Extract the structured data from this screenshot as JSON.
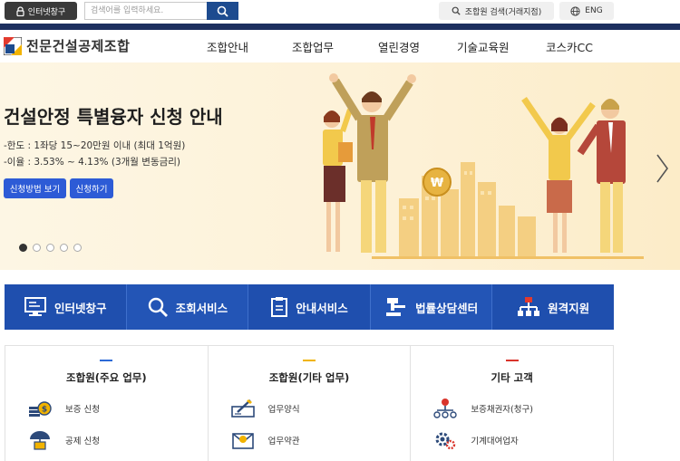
{
  "topbar": {
    "internet_window_label": "인터넷창구",
    "search_placeholder": "검색어를 입력하세요.",
    "member_search_label": "조합원 검색(거래지점)",
    "eng_label": "ENG"
  },
  "header": {
    "logo_text": "전문건설공제조합",
    "nav": [
      "조합안내",
      "조합업무",
      "열린경영",
      "기술교육원",
      "코스카CC"
    ]
  },
  "hero": {
    "title": "건설안정 특별융자 신청 안내",
    "lines": [
      "-한도 : 1좌당 15~20만원 이내 (최대 1억원)",
      "-이율 : 3.53% ~ 4.13% (3개월 변동금리)"
    ],
    "buttons": [
      "신청방법 보기",
      "신청하기"
    ],
    "coin_symbol": "₩",
    "slide_count": 5,
    "active_slide": 1
  },
  "quick_menu": [
    "인터넷창구",
    "조회서비스",
    "안내서비스",
    "법률상담센터",
    "원격지원"
  ],
  "panels": [
    {
      "title": "조합원(주요 업무)",
      "mark_color": "#2d6ad6",
      "items": [
        "보증 신청",
        "공제 신청"
      ]
    },
    {
      "title": "조합원(기타 업무)",
      "mark_color": "#f0b400",
      "items": [
        "업무양식",
        "업무약관"
      ]
    },
    {
      "title": "기타 고객",
      "mark_color": "#d9342b",
      "items": [
        "보증채권자(청구)",
        "기계대여업자"
      ]
    }
  ],
  "colors": {
    "navy": "#1d2f5f",
    "quick_blue": "#2355b6",
    "hero_button": "#2d5bd6"
  }
}
